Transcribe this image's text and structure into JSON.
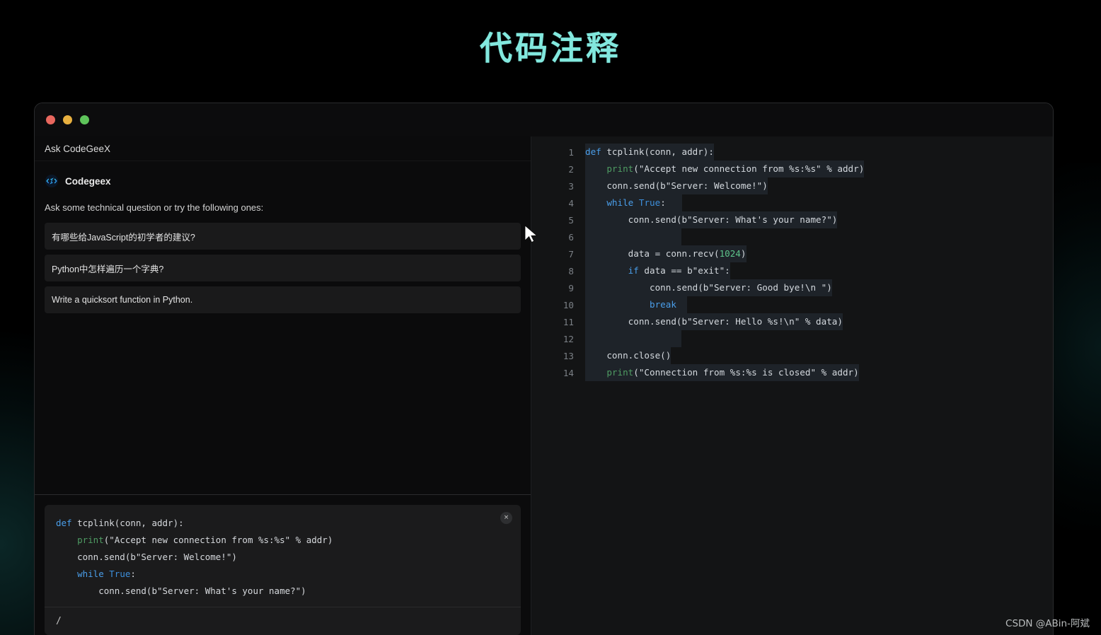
{
  "page": {
    "title": "代码注释",
    "title_color": "#82e8de",
    "background_color": "#000000",
    "watermark": "CSDN @ABin-阿斌"
  },
  "window": {
    "traffic_lights": [
      {
        "name": "close",
        "color": "#e8675e"
      },
      {
        "name": "minimize",
        "color": "#e8b03f"
      },
      {
        "name": "maximize",
        "color": "#5ec45a"
      }
    ]
  },
  "chat": {
    "header_title": "Ask CodeGeeX",
    "bot_name": "Codegeex",
    "intro": "Ask some technical question or try the following ones:",
    "suggestions": [
      "有哪些给JavaScript的初学者的建议?",
      "Python中怎样遍历一个字典?",
      "Write a quicksort function in Python."
    ]
  },
  "composer": {
    "close_label": "×",
    "input_value": "/",
    "input_placeholder": "/",
    "code_lines": [
      "def tcplink(conn, addr):",
      "    print(\"Accept new connection from %s:%s\" % addr)",
      "    conn.send(b\"Server: Welcome!\")",
      "    while True:",
      "        conn.send(b\"Server: What's your name?\")"
    ]
  },
  "editor": {
    "lines": [
      {
        "n": "1",
        "text": "def tcplink(conn, addr):"
      },
      {
        "n": "2",
        "text": "    print(\"Accept new connection from %s:%s\" % addr)"
      },
      {
        "n": "3",
        "text": "    conn.send(b\"Server: Welcome!\")"
      },
      {
        "n": "4",
        "text": "    while True:"
      },
      {
        "n": "5",
        "text": "        conn.send(b\"Server: What's your name?\")"
      },
      {
        "n": "6",
        "text": ""
      },
      {
        "n": "7",
        "text": "        data = conn.recv(1024)"
      },
      {
        "n": "8",
        "text": "        if data == b\"exit\":"
      },
      {
        "n": "9",
        "text": "            conn.send(b\"Server: Good bye!\\n \")"
      },
      {
        "n": "10",
        "text": "            break"
      },
      {
        "n": "11",
        "text": "        conn.send(b\"Server: Hello %s!\\n\" % data)"
      },
      {
        "n": "12",
        "text": ""
      },
      {
        "n": "13",
        "text": "    conn.close()"
      },
      {
        "n": "14",
        "text": "    print(\"Connection from %s:%s is closed\" % addr)"
      }
    ]
  }
}
